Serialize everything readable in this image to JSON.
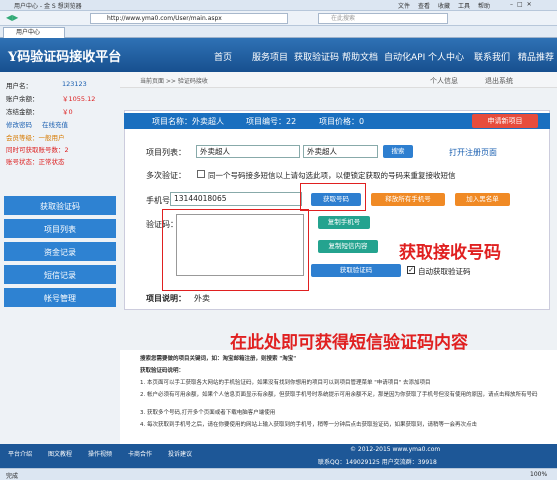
{
  "browser": {
    "title": "用户中心 - 金 S 想浏览器",
    "url": "http://www.yma0.com/User/main.aspx",
    "menu": [
      "文件",
      "查看",
      "收藏",
      "工具",
      "帮助"
    ],
    "search_placeholder": "在此搜索",
    "tab": "用户中心",
    "zoom": "100%",
    "status": "完成"
  },
  "header": {
    "logo": "Y码验证码接收平台",
    "nav": [
      "首页",
      "服务项目",
      "获取验证码",
      "帮助文档",
      "自动化API",
      "个人中心",
      "联系我们",
      "精品推荐"
    ],
    "links": [
      "个人信息",
      "退出系统"
    ]
  },
  "crumb": "当前页面 >> 验证码接收",
  "account": {
    "user_label": "用户名：",
    "user": "123123",
    "balance_label": "账户余额：",
    "balance": "￥1055.12",
    "frozen_label": "冻结金额：",
    "frozen": "￥0",
    "change_pwd": "修改密码",
    "recharge": "在线充值",
    "level": "会员等级：一般用户",
    "max": "同时可获取账号数：",
    "max_v": "2",
    "state": "账号状态：正常状态"
  },
  "menu": [
    "获取验证码",
    "项目列表",
    "资金记录",
    "短信记录",
    "帐号管理"
  ],
  "project": {
    "name_label": "项目名称：",
    "name": "外卖超人",
    "id_label": "项目编号：",
    "id": "22",
    "price_label": "项目价格：",
    "price": "0",
    "apply_btn": "申请新项目"
  },
  "form": {
    "list_label": "项目列表：",
    "list_select": "外卖超人",
    "list_value": "外卖超人",
    "search_btn": "搜索",
    "open_reg": "打开注册页面",
    "multi_label": "多次验证：",
    "multi_text": "同一个号码接多短信以上请勾选此项，以便锁定获取的号码来重复接收短信",
    "phone_label": "手机号：",
    "phone": "13144018065",
    "get_phone_btn": "获取号码",
    "release_btn": "释放所有手机号",
    "blacklist_btn": "加入黑名单",
    "copy_phone_btn": "复制手机号",
    "code_label": "验证码：",
    "copy_sms_btn": "复制短信内容",
    "get_code_btn": "获取验证码",
    "auto_label": "自动获取验证码",
    "desc_label": "项目说明：",
    "desc": "外卖"
  },
  "annotations": {
    "a1": "获取接收号码",
    "a2": "在此处即可获得短信验证码内容"
  },
  "notes": {
    "head": "搜索您需要做的项目关键词，如：淘宝邮箱注册，则搜索 \"淘宝\"",
    "title": "获取验证码说明：",
    "lines": [
      "1. 本页面可以手工获取各大网站的手机验证码，如果没有找到你想用的项目可以到项目管理菜单 \"申请项目\" 去添加项目",
      "2. 帐户必须有可用余额，如果个人信息页面显示有余额，但获取手机号时系统提示可用余额不足，那是因为你获取了手机号但没有使用的原因，请点击释放所有号码",
      "3. 获取多个号码,打开多个页面或者下载电脑客户端使用",
      "4. 每次获取到手机号之后，请在你要使用的网站上输入获取到的手机号，稍等一分钟后点击获取验证码，如果获取到，请稍等一会再次点击"
    ]
  },
  "footer": {
    "links": [
      "平台介绍",
      "图文教程",
      "操作视频",
      "卡商合作",
      "投诉建议"
    ],
    "copy": "© 2012-2015 www.yma0.com",
    "qq": "联系QQ：149029125 用户交流群：39918"
  }
}
